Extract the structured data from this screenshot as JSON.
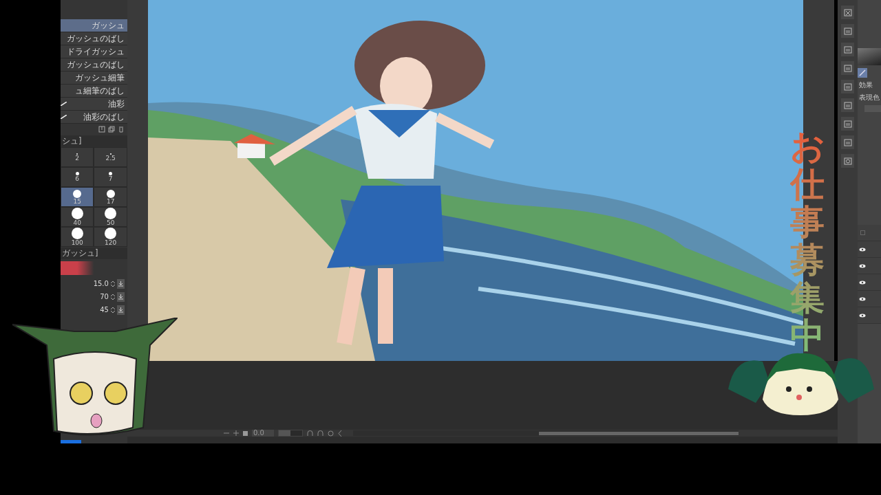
{
  "brush_list": {
    "items": [
      {
        "label": "ガッシュ",
        "selected": true,
        "kind": "plain"
      },
      {
        "label": "ガッシュのばし",
        "selected": false,
        "kind": "plain"
      },
      {
        "label": "ドライガッシュ",
        "selected": false,
        "kind": "plain"
      },
      {
        "label": "ガッシュのばし",
        "selected": false,
        "kind": "plain"
      },
      {
        "label": "ガッシュ細筆",
        "selected": false,
        "kind": "plain"
      },
      {
        "label": "ュ細筆のばし",
        "selected": false,
        "kind": "plain"
      },
      {
        "label": "油彩",
        "selected": false,
        "kind": "stroke"
      },
      {
        "label": "油彩のばし",
        "selected": false,
        "kind": "stroke"
      }
    ]
  },
  "brush_size": {
    "title": "シュ]",
    "sizes": [
      {
        "label": "2",
        "kind": "tiny",
        "selected": false
      },
      {
        "label": "2.5",
        "kind": "tiny",
        "selected": false
      },
      {
        "label": "6",
        "kind": "small",
        "selected": false
      },
      {
        "label": "7",
        "kind": "small",
        "selected": false
      },
      {
        "label": "15",
        "kind": "medium",
        "selected": true
      },
      {
        "label": "17",
        "kind": "medium",
        "selected": false
      },
      {
        "label": "40",
        "kind": "large",
        "selected": false
      },
      {
        "label": "50",
        "kind": "large",
        "selected": false
      },
      {
        "label": "100",
        "kind": "large",
        "selected": false
      },
      {
        "label": "120",
        "kind": "large",
        "selected": false
      }
    ]
  },
  "tool_property": {
    "title": "ガッシュ]",
    "values": [
      "15.0",
      "70",
      "45"
    ]
  },
  "timeline": {
    "value": "0.0",
    "level": 0.5
  },
  "right_panel": {
    "effect_label": "効果",
    "color_label": "表現色"
  },
  "layers": [
    {
      "visible": false
    },
    {
      "visible": true
    },
    {
      "visible": true
    },
    {
      "visible": true
    },
    {
      "visible": true
    },
    {
      "visible": true
    }
  ],
  "promo_text": "お仕事募集中"
}
